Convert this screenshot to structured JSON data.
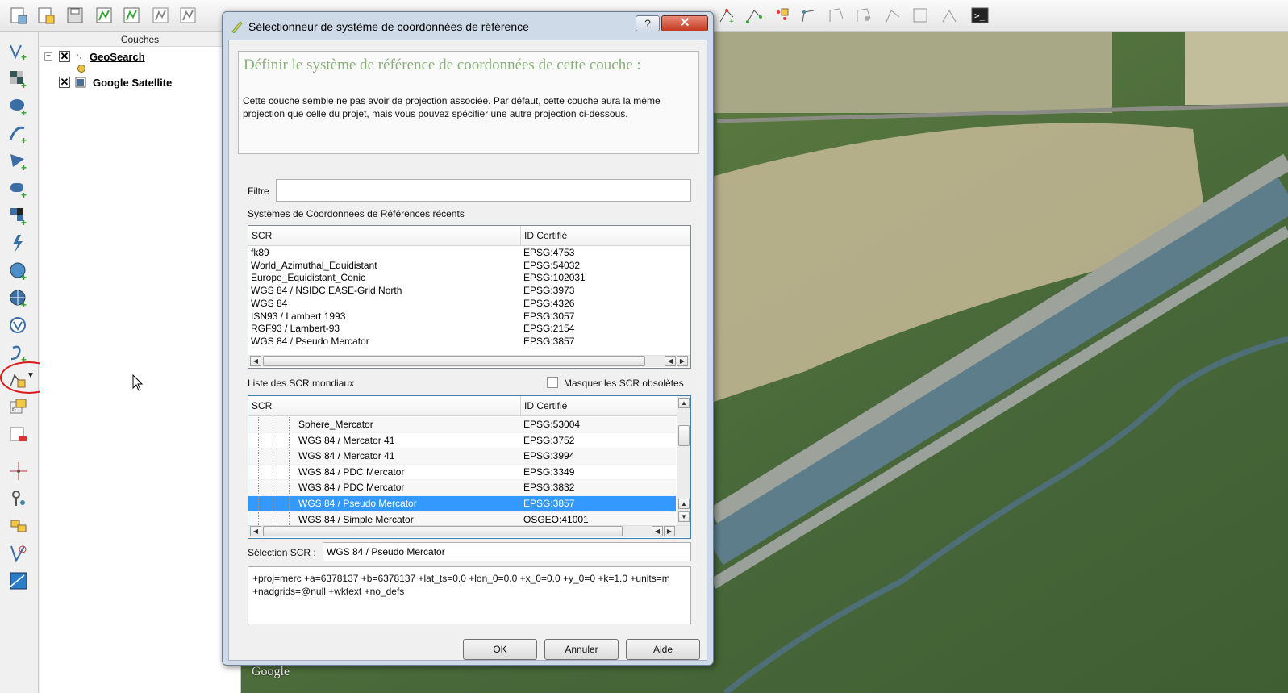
{
  "layers_panel": {
    "title": "Couches",
    "layers": [
      {
        "name": "GeoSearch"
      },
      {
        "name": "Google Satellite"
      }
    ]
  },
  "map": {
    "attribution": "Google"
  },
  "dialog": {
    "title": "Sélectionneur de système de coordonnées de référence",
    "help_label": "?",
    "close_label": "✕",
    "heading": "Définir le système de référence de coordonnées de cette couche :",
    "description": "Cette couche semble ne pas avoir de projection associée. Par défaut, cette couche aura la même projection que celle du projet, mais vous pouvez spécifier une autre projection ci-dessous.",
    "filter": {
      "label": "Filtre",
      "value": ""
    },
    "recent": {
      "label": "Systèmes de Coordonnées de Références récents",
      "columns": [
        "SCR",
        "ID Certifié"
      ],
      "rows": [
        {
          "name": "fk89",
          "id": "EPSG:4753"
        },
        {
          "name": "World_Azimuthal_Equidistant",
          "id": "EPSG:54032"
        },
        {
          "name": "Europe_Equidistant_Conic",
          "id": "EPSG:102031"
        },
        {
          "name": "WGS 84 / NSIDC EASE-Grid North",
          "id": "EPSG:3973"
        },
        {
          "name": "WGS 84",
          "id": "EPSG:4326"
        },
        {
          "name": "ISN93 / Lambert 1993",
          "id": "EPSG:3057"
        },
        {
          "name": "RGF93 / Lambert-93",
          "id": "EPSG:2154"
        },
        {
          "name": "WGS 84 / Pseudo Mercator",
          "id": "EPSG:3857"
        }
      ]
    },
    "world": {
      "label": "Liste des SCR mondiaux",
      "hide_deprecated_label": "Masquer les SCR obsolètes",
      "hide_deprecated_checked": false,
      "columns": [
        "SCR",
        "ID Certifié"
      ],
      "rows": [
        {
          "name": "Sphere_Mercator",
          "id": "EPSG:53004"
        },
        {
          "name": "WGS 84 / Mercator 41",
          "id": "EPSG:3752"
        },
        {
          "name": "WGS 84 / Mercator 41",
          "id": "EPSG:3994"
        },
        {
          "name": "WGS 84 / PDC Mercator",
          "id": "EPSG:3349"
        },
        {
          "name": "WGS 84 / PDC Mercator",
          "id": "EPSG:3832"
        },
        {
          "name": "WGS 84 / Pseudo Mercator",
          "id": "EPSG:3857"
        },
        {
          "name": "WGS 84 / Simple Mercator",
          "id": "OSGEO:41001"
        }
      ],
      "selected_index": 5
    },
    "selection": {
      "label": "Sélection SCR :",
      "value": "WGS 84 / Pseudo Mercator"
    },
    "proj_string": "+proj=merc +a=6378137 +b=6378137 +lat_ts=0.0 +lon_0=0.0 +x_0=0.0 +y_0=0 +k=1.0 +units=m +nadgrids=@null +wktext  +no_defs",
    "buttons": {
      "ok": "OK",
      "cancel": "Annuler",
      "help": "Aide"
    }
  },
  "colors": {
    "selection": "#3399ff",
    "heading": "#8ab07a",
    "close": "#c53a20",
    "annotation": "#d81a1a"
  }
}
